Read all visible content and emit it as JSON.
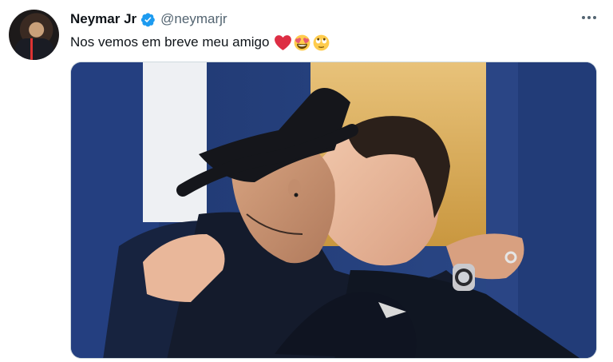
{
  "tweet": {
    "author_name": "Neymar Jr",
    "handle": "@neymarjr",
    "text": "Nos vemos em breve meu amigo",
    "emojis": [
      "red-heart",
      "smiling-face-with-heart-eyes",
      "face-with-rolling-eyes"
    ],
    "verified": true
  },
  "colors": {
    "name": "#0f1419",
    "secondary": "#536471",
    "verified": "#1d9bf0",
    "border": "#cfd9de"
  },
  "icons": {
    "more": "more-horizontal-icon",
    "verified": "verified-badge-icon"
  }
}
